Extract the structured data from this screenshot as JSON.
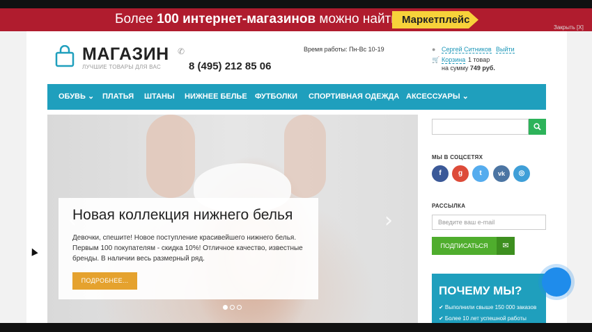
{
  "promo": {
    "prefix": "Более ",
    "number": "100",
    "bold": " интернет-магазинов",
    "suffix": " можно найти в",
    "badge": "Маркетплейс",
    "close": "Закрыть [X]"
  },
  "logo": {
    "title": "МАГАЗИН",
    "subtitle": "ЛУЧШИЕ ТОВАРЫ ДЛЯ ВАС"
  },
  "header": {
    "phone": "8 (495) 212 85 06",
    "hours": "Время работы: Пн-Вс 10-19",
    "user_name": "Сергей Ситников",
    "logout": "Выйти",
    "cart_link": "Корзина",
    "cart_count": "1 товар",
    "cart_sum_label": "на сумму ",
    "cart_sum_value": "749 руб."
  },
  "nav": {
    "items": [
      {
        "label": "ОБУВЬ ⌄"
      },
      {
        "label": "ПЛАТЬЯ"
      },
      {
        "label": "ШТАНЫ"
      },
      {
        "label": "НИЖНЕЕ БЕЛЬЕ"
      },
      {
        "label": "ФУТБОЛКИ"
      },
      {
        "label": "СПОРТИВНАЯ ОДЕЖДА"
      },
      {
        "label": "АКСЕССУАРЫ ⌄"
      }
    ]
  },
  "hero": {
    "title": "Новая коллекция нижнего белья",
    "text": "Девочки, спешите! Новое поступление красивейшего нижнего белья. Первым 100 покупателям - скидка 10%! Отличное качество, известные бренды. В наличии весь размерный ряд.",
    "button": "ПОДРОБНЕЕ...",
    "prev": "‹",
    "next": "›",
    "slide_count": 3,
    "active_slide": 1
  },
  "sidebar": {
    "social_title": "МЫ В СОЦСЕТЯХ",
    "social": [
      {
        "name": "facebook-icon",
        "glyph": "f",
        "color": "#3b5998"
      },
      {
        "name": "google-plus-icon",
        "glyph": "g",
        "color": "#dd4b39"
      },
      {
        "name": "twitter-icon",
        "glyph": "t",
        "color": "#55acee"
      },
      {
        "name": "vk-icon",
        "glyph": "vk",
        "color": "#4c75a3"
      },
      {
        "name": "instagram-icon",
        "glyph": "◎",
        "color": "#3f9fd8"
      }
    ],
    "newsletter_title": "РАССЫЛКА",
    "email_placeholder": "Введите ваш e-mail",
    "subscribe": "ПОДПИСАТЬСЯ",
    "why_title": "ПОЧЕМУ МЫ?",
    "why_items": [
      "✔ Выполнили свыше 150 000 заказов",
      "✔ Более 10 лет успешной работы"
    ]
  },
  "colors": {
    "brand": "#1f9fbd",
    "promo": "#b01c2e",
    "accent": "#e5a22e",
    "green": "#4fad2d"
  }
}
